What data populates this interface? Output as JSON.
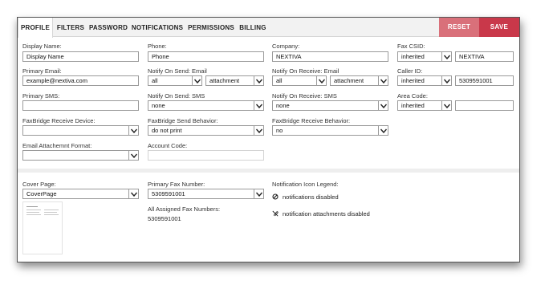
{
  "tabs": [
    {
      "label": "PROFILE",
      "active": true
    },
    {
      "label": "FILTERS"
    },
    {
      "label": "PASSWORD"
    },
    {
      "label": "NOTIFICATIONS"
    },
    {
      "label": "PERMISSIONS"
    },
    {
      "label": "BILLING"
    }
  ],
  "actions": {
    "reset": "RESET",
    "save": "SAVE"
  },
  "form": {
    "display_name": {
      "label": "Display Name:",
      "value": "Display Name"
    },
    "phone": {
      "label": "Phone:",
      "value": "Phone"
    },
    "company": {
      "label": "Company:",
      "value": "NEXTIVA"
    },
    "fax_csid": {
      "label": "Fax CSID:",
      "mode": "inherited",
      "value": "NEXTIVA"
    },
    "primary_email": {
      "label": "Primary Email:",
      "value": "example@nextiva.com"
    },
    "notify_on_send_email": {
      "label": "Notify On Send: Email",
      "scope": "all",
      "attach": "attachment"
    },
    "notify_on_receive_email": {
      "label": "Notify On Receive: Email",
      "scope": "all",
      "attach": "attachment"
    },
    "caller_id": {
      "label": "Caller ID:",
      "mode": "inherited",
      "value": "5309591001"
    },
    "primary_sms": {
      "label": "Primary SMS:",
      "value": ""
    },
    "notify_on_send_sms": {
      "label": "Notify On Send: SMS",
      "value": "none"
    },
    "notify_on_receive_sms": {
      "label": "Notify On Receive: SMS",
      "value": "none"
    },
    "area_code": {
      "label": "Area Code:",
      "mode": "inherited",
      "value": ""
    },
    "faxbridge_receive_device": {
      "label": "FaxBridge Receive Device:",
      "value": ""
    },
    "faxbridge_send_behavior": {
      "label": "FaxBridge Send Behavior:",
      "value": "do not print"
    },
    "faxbridge_receive_behavior": {
      "label": "FaxBridge Receive Behavior:",
      "value": "no"
    },
    "email_attachment_format": {
      "label": "Email Attachemnt Format:",
      "value": ""
    },
    "account_code": {
      "label": "Account Code:",
      "value": ""
    }
  },
  "lower": {
    "cover_page": {
      "label": "Cover Page:",
      "value": "CoverPage"
    },
    "primary_fax": {
      "label": "Primary Fax Number:",
      "value": "5309591001"
    },
    "all_assigned": {
      "label": "All Assigned Fax Numbers:",
      "value": "5309591001"
    },
    "legend": {
      "title": "Notification Icon Legend:",
      "items": [
        {
          "icon": "disabled-circle-icon",
          "text": "notifications disabled"
        },
        {
          "icon": "attachment-disabled-icon",
          "text": "notification attachments disabled"
        }
      ]
    }
  }
}
